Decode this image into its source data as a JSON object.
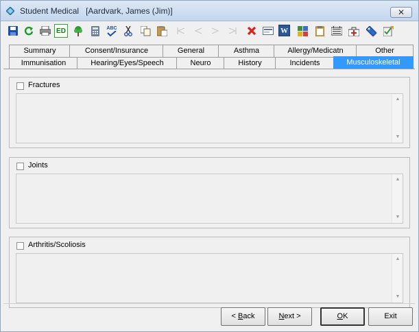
{
  "window": {
    "app_title": "Student Medical",
    "record_title": "[Aardvark, James (Jim)]",
    "close_symbol": "✕"
  },
  "toolbar": {
    "buttons": [
      {
        "icon": "save-icon"
      },
      {
        "icon": "refresh-icon"
      },
      {
        "icon": "print-icon"
      },
      {
        "icon": "ed-icon",
        "text": "ED"
      },
      {
        "icon": "tree-icon"
      },
      {
        "icon": "calculator-icon"
      },
      {
        "icon": "spellcheck-icon",
        "text": "ABC"
      },
      {
        "icon": "cut-icon"
      },
      {
        "icon": "copy-icon"
      },
      {
        "icon": "paste-icon"
      },
      {
        "icon": "first-record-icon"
      },
      {
        "icon": "previous-record-icon"
      },
      {
        "icon": "next-record-icon"
      },
      {
        "icon": "last-record-icon"
      },
      {
        "icon": "delete-icon"
      },
      {
        "icon": "card-icon"
      },
      {
        "icon": "word-icon",
        "text": "W"
      },
      {
        "icon": "puzzle-icon"
      },
      {
        "icon": "clipboard-icon"
      },
      {
        "icon": "register-icon"
      },
      {
        "icon": "medical-kit-icon"
      },
      {
        "icon": "tag-icon"
      },
      {
        "icon": "checklist-icon"
      }
    ]
  },
  "tabs": {
    "row1": [
      "Summary",
      "Consent/Insurance",
      "General",
      "Asthma",
      "Allergy/Medicatn",
      "Other"
    ],
    "row2": [
      "Immunisation",
      "Hearing/Eyes/Speech",
      "Neuro",
      "History",
      "Incidents",
      "Musculoskeletal"
    ],
    "active": "Musculoskeletal"
  },
  "sections": [
    {
      "label": "Fractures",
      "checked": false,
      "text": ""
    },
    {
      "label": "Joints",
      "checked": false,
      "text": ""
    },
    {
      "label": "Arthritis/Scoliosis",
      "checked": false,
      "text": ""
    }
  ],
  "buttons": {
    "back_prefix": "< ",
    "back_key": "B",
    "back_rest": "ack",
    "next_key": "N",
    "next_rest": "ext >",
    "ok_key": "O",
    "ok_rest": "K",
    "exit": "Exit"
  },
  "colors": {
    "active_tab": "#3399ff",
    "delete_icon": "#d8231b",
    "save_icon": "#1c4fa8"
  }
}
